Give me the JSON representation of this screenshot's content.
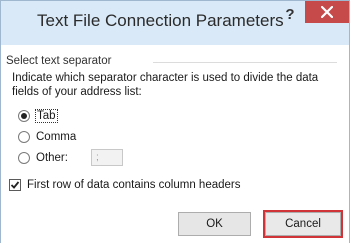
{
  "dialog": {
    "title": "Text File Connection Parameters",
    "help_label": "?",
    "group_label": "Select text separator",
    "description": "Indicate which separator character is used to divide the data fields of your address list:",
    "separators": [
      {
        "label": "Tab",
        "checked": true
      },
      {
        "label": "Comma",
        "checked": false
      },
      {
        "label": "Other:",
        "checked": false
      }
    ],
    "other_value": ";",
    "header_checkbox_label": "First row of data contains column headers",
    "header_checkbox_checked": true,
    "ok_label": "OK",
    "cancel_label": "Cancel"
  },
  "colors": {
    "titlebar": "#d9e9f7",
    "close_button": "#c74a4a",
    "highlight": "#d13438"
  }
}
